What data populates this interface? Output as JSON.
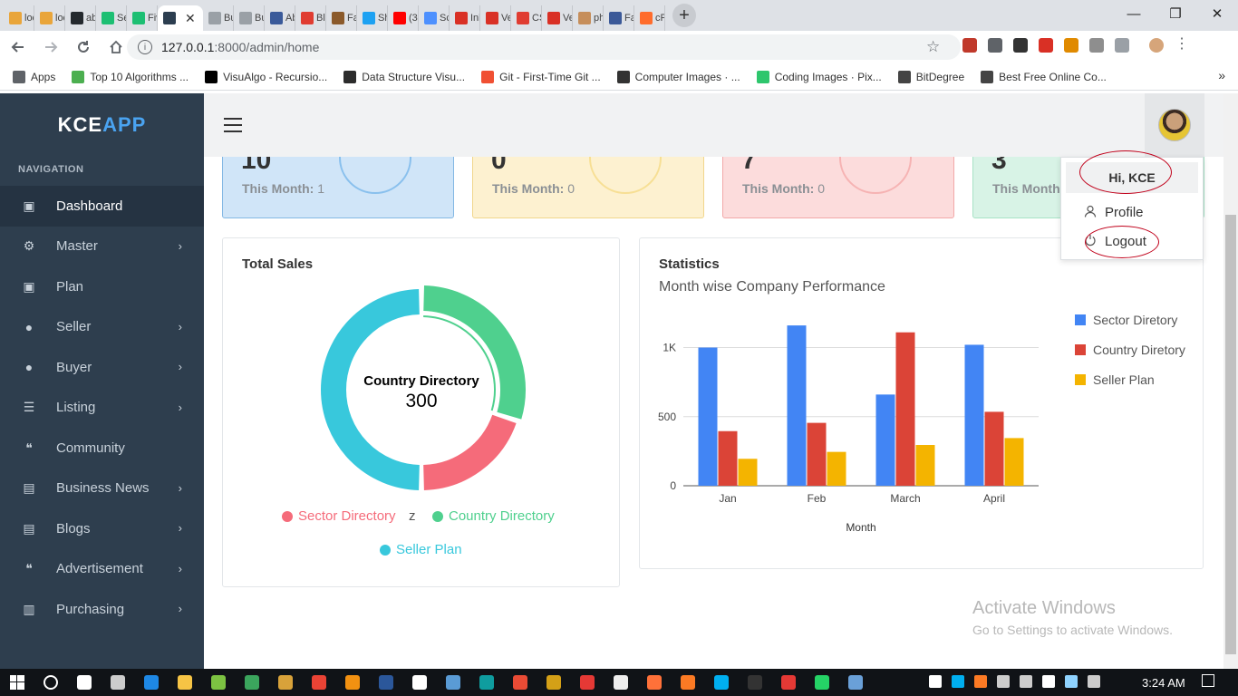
{
  "browser": {
    "tabs": [
      {
        "label": "loc",
        "color": "#e9a53a"
      },
      {
        "label": "loc",
        "color": "#e9a53a"
      },
      {
        "label": "ab",
        "color": "#24292e"
      },
      {
        "label": "Se",
        "color": "#1dbf73"
      },
      {
        "label": "Fiv",
        "color": "#1dbf73"
      },
      {
        "label": "",
        "color": "#2c3e50",
        "active": true
      },
      {
        "label": "Bu",
        "color": "#9aa0a6"
      },
      {
        "label": "Bu",
        "color": "#9aa0a6"
      },
      {
        "label": "Ab",
        "color": "#3a5a9a"
      },
      {
        "label": "Bla",
        "color": "#e03c31"
      },
      {
        "label": "Fav",
        "color": "#8b5a2b"
      },
      {
        "label": "Sh",
        "color": "#1da1f2"
      },
      {
        "label": "(32",
        "color": "#ff0000"
      },
      {
        "label": "Sc",
        "color": "#4d90fe"
      },
      {
        "label": "Inb",
        "color": "#d93025"
      },
      {
        "label": "Ve",
        "color": "#d93025"
      },
      {
        "label": "CS",
        "color": "#e03c31"
      },
      {
        "label": "Ve",
        "color": "#d93025"
      },
      {
        "label": "ph",
        "color": "#c68e5b"
      },
      {
        "label": "Fac",
        "color": "#3b5998"
      },
      {
        "label": "cP",
        "color": "#ff6c2c"
      }
    ],
    "active_tab_close": "✕",
    "new_tab": "+",
    "window_controls": [
      "—",
      "❐",
      "✕"
    ],
    "url_host": "127.0.0.1",
    "url_path": ":8000/admin/home",
    "bookmarks": [
      {
        "label": "Apps",
        "color": "#5f6368"
      },
      {
        "label": "Top 10 Algorithms ...",
        "color": "#4caf50"
      },
      {
        "label": "VisuAlgo - Recursio...",
        "color": "#000000"
      },
      {
        "label": "Data Structure Visu...",
        "color": "#2c2c2c"
      },
      {
        "label": "Git - First-Time Git ...",
        "color": "#f05033"
      },
      {
        "label": "Computer Images · ...",
        "color": "#333333"
      },
      {
        "label": "Coding Images · Pix...",
        "color": "#2ec66d"
      },
      {
        "label": "BitDegree",
        "color": "#444444"
      },
      {
        "label": "Best Free Online Co...",
        "color": "#444444"
      }
    ],
    "bookmarks_more": "»"
  },
  "sidebar": {
    "brand_main": "KCE",
    "brand_accent": "APP",
    "heading": "NAVIGATION",
    "items": [
      {
        "label": "Dashboard",
        "icon": "calendar-icon",
        "glyph": "▣",
        "active": true,
        "chevron": false
      },
      {
        "label": "Master",
        "icon": "cogs-icon",
        "glyph": "⚙",
        "active": false,
        "chevron": true
      },
      {
        "label": "Plan",
        "icon": "calendar-icon",
        "glyph": "▣",
        "active": false,
        "chevron": false
      },
      {
        "label": "Seller",
        "icon": "user-icon",
        "glyph": "●",
        "active": false,
        "chevron": true
      },
      {
        "label": "Buyer",
        "icon": "user-icon",
        "glyph": "●",
        "active": false,
        "chevron": true
      },
      {
        "label": "Listing",
        "icon": "list-icon",
        "glyph": "☰",
        "active": false,
        "chevron": true
      },
      {
        "label": "Community",
        "icon": "comments-icon",
        "glyph": "❝",
        "active": false,
        "chevron": false
      },
      {
        "label": "Business News",
        "icon": "newspaper-icon",
        "glyph": "▤",
        "active": false,
        "chevron": true
      },
      {
        "label": "Blogs",
        "icon": "newspaper-icon",
        "glyph": "▤",
        "active": false,
        "chevron": true
      },
      {
        "label": "Advertisement",
        "icon": "comments-icon",
        "glyph": "❝",
        "active": false,
        "chevron": true
      },
      {
        "label": "Purchasing",
        "icon": "money-icon",
        "glyph": "▥",
        "active": false,
        "chevron": true
      }
    ],
    "chevron": "›"
  },
  "stats": [
    {
      "number": "10",
      "month_label": "This Month:",
      "month_value": "1"
    },
    {
      "number": "0",
      "month_label": "This Month:",
      "month_value": "0"
    },
    {
      "number": "7",
      "month_label": "This Month:",
      "month_value": "0"
    },
    {
      "number": "3",
      "month_label": "This Month:",
      "month_value": ""
    }
  ],
  "total_sales": {
    "title": "Total Sales",
    "center_label": "Country Directory",
    "center_value": "300",
    "legend": [
      {
        "label": "Sector Directory",
        "color": "#f56b7a"
      },
      {
        "label": "z",
        "color": "#555555"
      },
      {
        "label": "Country Directory",
        "color": "#4fd08e"
      },
      {
        "label": "Seller Plan",
        "color": "#38c8dc"
      }
    ]
  },
  "statistics": {
    "title": "Statistics",
    "subtitle": "Month wise Company Performance",
    "xlabel": "Month"
  },
  "chart_data": [
    {
      "type": "pie",
      "title": "Total Sales",
      "categories": [
        "Sector Directory",
        "Country Directory",
        "Seller Plan"
      ],
      "values": [
        20,
        30,
        50
      ],
      "colors": [
        "#f56b7a",
        "#4fd08e",
        "#38c8dc"
      ]
    },
    {
      "type": "bar",
      "title": "Month wise Company Performance",
      "xlabel": "Month",
      "ylabel": "",
      "categories": [
        "Jan",
        "Feb",
        "March",
        "April"
      ],
      "ylim": [
        0,
        1200
      ],
      "yticks": [
        0,
        500,
        1000
      ],
      "ytick_labels": [
        "0",
        "500",
        "1K"
      ],
      "grid": true,
      "legend_position": "right",
      "series": [
        {
          "name": "Sector Diretory",
          "color": "#4285f4",
          "values": [
            1000,
            1160,
            660,
            1020
          ]
        },
        {
          "name": "Country Diretory",
          "color": "#db4437",
          "values": [
            395,
            455,
            1110,
            535
          ]
        },
        {
          "name": "Seller Plan",
          "color": "#f4b400",
          "values": [
            195,
            245,
            295,
            345
          ]
        }
      ]
    }
  ],
  "user_menu": {
    "greeting": "Hi, KCE",
    "profile": "Profile",
    "logout": "Logout"
  },
  "watermark": {
    "line1": "Activate Windows",
    "line2": "Go to Settings to activate Windows."
  },
  "taskbar": {
    "time": "3:24 AM",
    "apps": [
      "#0078d7",
      "#ffffff",
      "#cccccc",
      "#1e88e5",
      "#f6c445",
      "#7cc242",
      "#3ba55d",
      "#d8a23a",
      "#ea4335",
      "#f29111",
      "#2b579a",
      "#ffffff",
      "#5a9bd5",
      "#0f9d9f",
      "#e94b35",
      "#d4a017",
      "#e53935",
      "#eeeeee",
      "#ff7139",
      "#fb7a24",
      "#00aff0",
      "#333333",
      "#e53935",
      "#25d366",
      "#6aa0d8"
    ],
    "tray": [
      "#ffffff",
      "#00aff0",
      "#fb7a24",
      "#cccccc",
      "#cccccc",
      "#ffffff",
      "#8fd3ff",
      "#cccccc"
    ]
  }
}
